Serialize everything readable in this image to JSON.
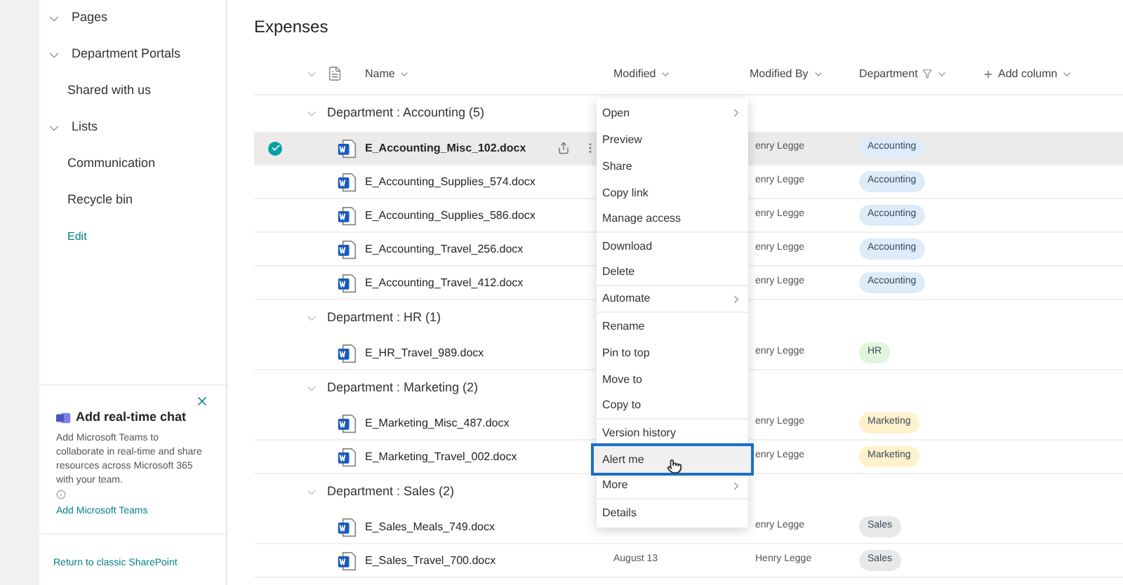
{
  "sidebar": {
    "items": [
      {
        "label": "Pages",
        "kind": "group"
      },
      {
        "label": "Department Portals",
        "kind": "group"
      },
      {
        "label": "Shared with us",
        "kind": "link"
      },
      {
        "label": "Lists",
        "kind": "group"
      },
      {
        "label": "Communication",
        "kind": "link"
      },
      {
        "label": "Recycle bin",
        "kind": "link"
      },
      {
        "label": "Edit",
        "kind": "action"
      }
    ],
    "teams_card": {
      "title": "Add real-time chat",
      "description": "Add Microsoft Teams to collaborate in real-time and share resources across Microsoft 365 with your team.",
      "link": "Add Microsoft Teams"
    },
    "footer_link": "Return to classic SharePoint"
  },
  "page_title": "Expenses",
  "table": {
    "columns": [
      {
        "label": "Name"
      },
      {
        "label": "Modified"
      },
      {
        "label": "Modified By"
      },
      {
        "label": "Department",
        "filtered": true
      },
      {
        "label": "Add column",
        "kind": "add"
      }
    ],
    "groups": [
      {
        "label": "Department : Accounting (5)",
        "rows": [
          {
            "name": "E_Accounting_Misc_102.docx",
            "modified_by": "enry Legge",
            "department": "Accounting",
            "color": "#deecf9",
            "selected": true
          },
          {
            "name": "E_Accounting_Supplies_574.docx",
            "modified_by": "enry Legge",
            "department": "Accounting",
            "color": "#deecf9",
            "selected": false
          },
          {
            "name": "E_Accounting_Supplies_586.docx",
            "modified_by": "enry Legge",
            "department": "Accounting",
            "color": "#deecf9",
            "selected": false
          },
          {
            "name": "E_Accounting_Travel_256.docx",
            "modified_by": "enry Legge",
            "department": "Accounting",
            "color": "#deecf9",
            "selected": false
          },
          {
            "name": "E_Accounting_Travel_412.docx",
            "modified_by": "enry Legge",
            "department": "Accounting",
            "color": "#deecf9",
            "selected": false
          }
        ]
      },
      {
        "label": "Department : HR (1)",
        "rows": [
          {
            "name": "E_HR_Travel_989.docx",
            "modified_by": "enry Legge",
            "department": "HR",
            "color": "#dff6dd",
            "selected": false
          }
        ]
      },
      {
        "label": "Department : Marketing (2)",
        "rows": [
          {
            "name": "E_Marketing_Misc_487.docx",
            "modified_by": "enry Legge",
            "department": "Marketing",
            "color": "#fff1cc",
            "selected": false
          },
          {
            "name": "E_Marketing_Travel_002.docx",
            "modified_by": "enry Legge",
            "department": "Marketing",
            "color": "#fff1cc",
            "selected": false
          }
        ]
      },
      {
        "label": "Department : Sales (2)",
        "rows": [
          {
            "name": "E_Sales_Meals_749.docx",
            "modified_by": "enry Legge",
            "department": "Sales",
            "color": "#e8e8e8",
            "selected": false
          },
          {
            "name": "E_Sales_Travel_700.docx",
            "modified": "August 13",
            "modified_by": "Henry Legge",
            "department": "Sales",
            "color": "#e8e8e8",
            "selected": false
          }
        ]
      }
    ]
  },
  "context_menu": {
    "items": [
      {
        "label": "Open",
        "submenu": true,
        "separator": false,
        "selected": false
      },
      {
        "label": "Preview",
        "submenu": false,
        "separator": false,
        "selected": false
      },
      {
        "label": "Share",
        "submenu": false,
        "separator": false,
        "selected": false
      },
      {
        "label": "Copy link",
        "submenu": false,
        "separator": false,
        "selected": false
      },
      {
        "label": "Manage access",
        "submenu": false,
        "separator": true,
        "selected": false
      },
      {
        "label": "Download",
        "submenu": false,
        "separator": false,
        "selected": false
      },
      {
        "label": "Delete",
        "submenu": false,
        "separator": true,
        "selected": false
      },
      {
        "label": "Automate",
        "submenu": true,
        "separator": true,
        "selected": false
      },
      {
        "label": "Rename",
        "submenu": false,
        "separator": false,
        "selected": false
      },
      {
        "label": "Pin to top",
        "submenu": false,
        "separator": false,
        "selected": false
      },
      {
        "label": "Move to",
        "submenu": false,
        "separator": false,
        "selected": false
      },
      {
        "label": "Copy to",
        "submenu": false,
        "separator": true,
        "selected": false
      },
      {
        "label": "Version history",
        "submenu": false,
        "separator": false,
        "selected": false
      },
      {
        "label": "Alert me",
        "submenu": false,
        "separator": false,
        "selected": true
      },
      {
        "label": "More",
        "submenu": true,
        "separator": true,
        "selected": false
      },
      {
        "label": "Details",
        "submenu": false,
        "separator": false,
        "selected": false
      }
    ]
  }
}
